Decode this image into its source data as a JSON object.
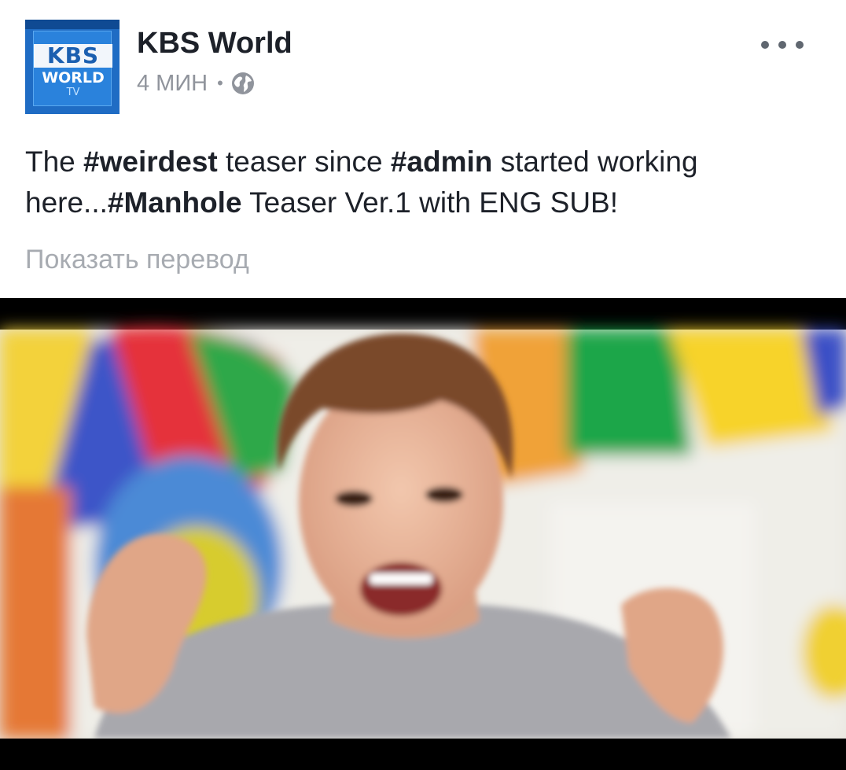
{
  "page": {
    "name": "KBS World",
    "avatar": {
      "line1": "KBS",
      "line2": "WORLD",
      "line3": "TV"
    },
    "time": "4 МИН",
    "separator": "•",
    "privacy_icon": "globe-icon"
  },
  "post": {
    "segments": [
      {
        "text": "The ",
        "bold": false
      },
      {
        "text": "#weirdest",
        "bold": true
      },
      {
        "text": " teaser since ",
        "bold": false
      },
      {
        "text": "#admin",
        "bold": true
      },
      {
        "text": " started working here...",
        "bold": false
      },
      {
        "text": "#Manhole",
        "bold": true
      },
      {
        "text": " Teaser Ver.1 with ENG SUB!",
        "bold": false
      }
    ],
    "translate_label": "Показать перевод"
  },
  "menu": {
    "icon": "more-options-icon"
  },
  "colors": {
    "text": "#1d2129",
    "muted": "#90949c",
    "link": "#a7abb1"
  }
}
